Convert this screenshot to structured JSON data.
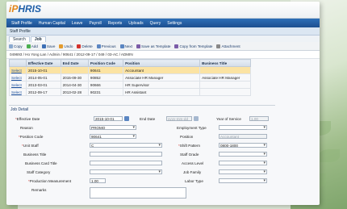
{
  "app": {
    "logo_prefix": "iP",
    "logo_name": "HRIS"
  },
  "menu": [
    "Staff Profile",
    "Human Capital",
    "Leave",
    "Payroll",
    "Reports",
    "Uploads",
    "Query",
    "Settings"
  ],
  "page_title": "Staff Profile",
  "subtabs": [
    "Search",
    "Job"
  ],
  "toolbar": [
    "Copy",
    "Add",
    "Save",
    "Undo",
    "Delete",
    "Previous",
    "Next",
    "Save as Template",
    "Copy from Template",
    "Attachment"
  ],
  "breadcrumb": "049693 / Ho Yong Lan / Admin / 90641 / 2012-09-17 / 049 / 03-AC / ADMIN",
  "grid": {
    "headers": [
      "",
      "Effective Date",
      "End Date",
      "Position Code",
      "Position",
      "Business Title"
    ],
    "rows": [
      [
        "Select",
        "2015-10-01",
        "",
        "90641",
        "Accountant",
        ""
      ],
      [
        "Select",
        "2014-05-01",
        "2015-09-30",
        "90852",
        "Associate HR Manager",
        "Associate HR Manager"
      ],
      [
        "Select",
        "2013-03-01",
        "2014-04-30",
        "90666",
        "HR Supervisor",
        ""
      ],
      [
        "Select",
        "2012-09-17",
        "2013-02-28",
        "90231",
        "HR Assistant",
        ""
      ]
    ]
  },
  "detail": {
    "title": "Job Detail",
    "labels": {
      "effective_date": "Effective Date",
      "end_date": "End Date",
      "years_of_service": "Year of Service",
      "reason": "Reason",
      "employment_type": "Employment Type",
      "position_code": "Position Code",
      "position": "Position",
      "unit_staff": "Unit Staff",
      "shift_pattern": "Shift Pattern",
      "business_title": "Business Title",
      "staff_grade": "Staff Grade",
      "business_card_title": "Business Card Title",
      "access_level": "Access Level",
      "staff_category": "Staff Category",
      "job_family": "Job Family",
      "production_measurement": "Production Measurement",
      "labor_type": "Labor Type",
      "remarks": "Remarks"
    },
    "values": {
      "effective_date": "2015-10-01",
      "end_date": "yyyy-mm-dd",
      "years_of_service": "1.00",
      "reason": "PROMO",
      "position_code": "90641",
      "position": "Accountant",
      "unit_staff": "C",
      "shift_pattern": "0800-1800",
      "production_measurement": "1.00"
    }
  },
  "colors": {
    "menu_bar": "#1d4f8f",
    "selected_row": "#fbe3a3",
    "link": "#1b4f9c",
    "required": "#d3322c"
  }
}
